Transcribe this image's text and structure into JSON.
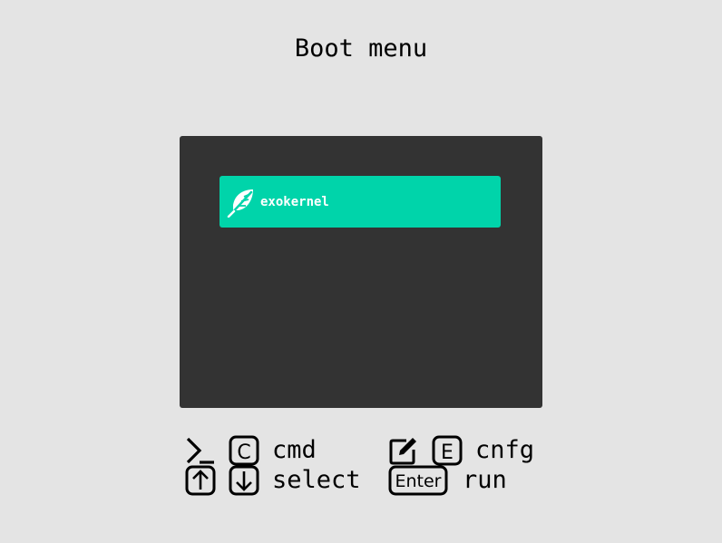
{
  "header": {
    "title": "Boot menu"
  },
  "menu": {
    "entries": [
      {
        "label": "exokernel",
        "icon": "feather-icon",
        "selected": true
      }
    ]
  },
  "hints": {
    "cmd": {
      "keys": [
        "terminal-icon",
        "C"
      ],
      "label": "cmd"
    },
    "cnfg": {
      "keys": [
        "edit-icon",
        "E"
      ],
      "label": "cnfg"
    },
    "select": {
      "keys": [
        "arrow-up-icon",
        "arrow-down-icon"
      ],
      "label": "select"
    },
    "run": {
      "keys": [
        "Enter"
      ],
      "label": "run"
    }
  },
  "colors": {
    "background": "#e4e4e4",
    "panel": "#333333",
    "selected_entry": "#00d4aa",
    "entry_text": "#ffffff"
  }
}
